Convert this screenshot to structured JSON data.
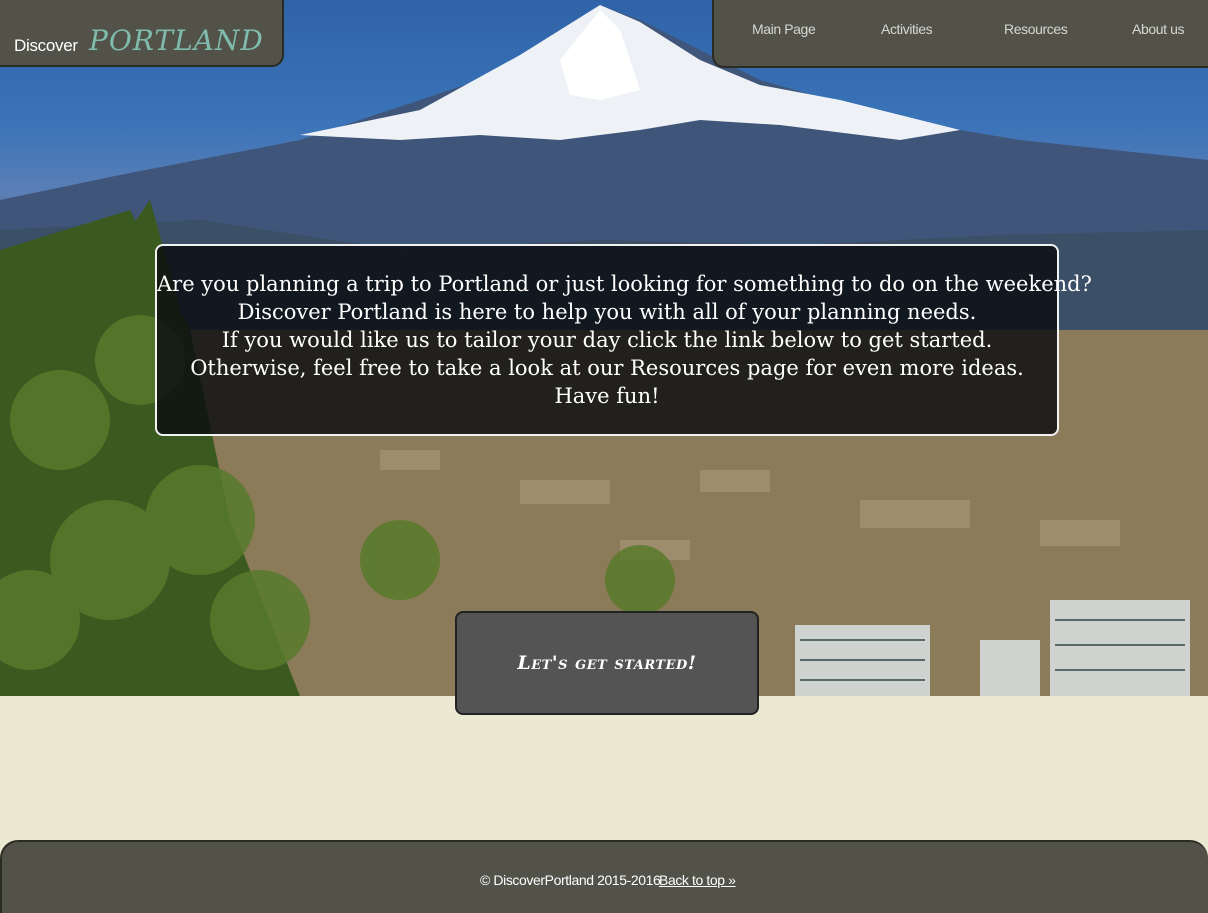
{
  "brand": {
    "small": "Discover",
    "large": "PORTLAND"
  },
  "nav": {
    "items": [
      {
        "label": "Main Page"
      },
      {
        "label": "Activities"
      },
      {
        "label": "Resources"
      },
      {
        "label": "About us"
      }
    ]
  },
  "intro": {
    "lines": [
      "Are you planning a trip to Portland or just looking for something to do on the weekend?",
      "Discover Portland is here to help you with all of your planning needs.",
      "If you would like us to tailor your day click the link below to get started.",
      "Otherwise, feel free to take a look at our Resources page for even more ideas.",
      "Have fun!"
    ]
  },
  "cta": {
    "label": "Let's get started!"
  },
  "footer": {
    "copyright": "© DiscoverPortland 2015-2016",
    "back_to_top": "Back to top »"
  },
  "colors": {
    "nav_bg": "#525249",
    "brand_accent": "#7fbcae",
    "page_bg": "#ece9d2",
    "button_bg": "#545454"
  }
}
